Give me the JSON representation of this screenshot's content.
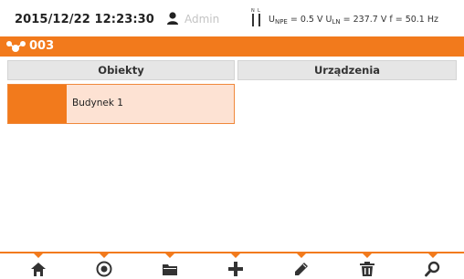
{
  "status": {
    "datetime": "2015/12/22 12:23:30",
    "user_icon": "user-icon",
    "user": "Admin",
    "probe_icon": "probe-icon",
    "u_npe_label": "U",
    "u_npe_sub": "NPE",
    "u_npe_value": " = 0.5 V ",
    "u_ln_label": "U",
    "u_ln_sub": "LN",
    "u_ln_value": " = 237.7 V ",
    "freq": "f = 50.1 Hz"
  },
  "title_bar": {
    "icon": "object-tree-icon",
    "title": "003",
    "color": "#f27a1c"
  },
  "columns": {
    "objects_header": "Obiekty",
    "devices_header": "Urządzenia"
  },
  "objects": [
    {
      "label": "Budynek 1",
      "selected": true
    }
  ],
  "toolbar": {
    "buttons": [
      {
        "icon": "home-icon"
      },
      {
        "icon": "target-icon"
      },
      {
        "icon": "folder-icon"
      },
      {
        "icon": "plus-icon"
      },
      {
        "icon": "pencil-icon"
      },
      {
        "icon": "trash-icon"
      },
      {
        "icon": "search-icon"
      }
    ]
  }
}
